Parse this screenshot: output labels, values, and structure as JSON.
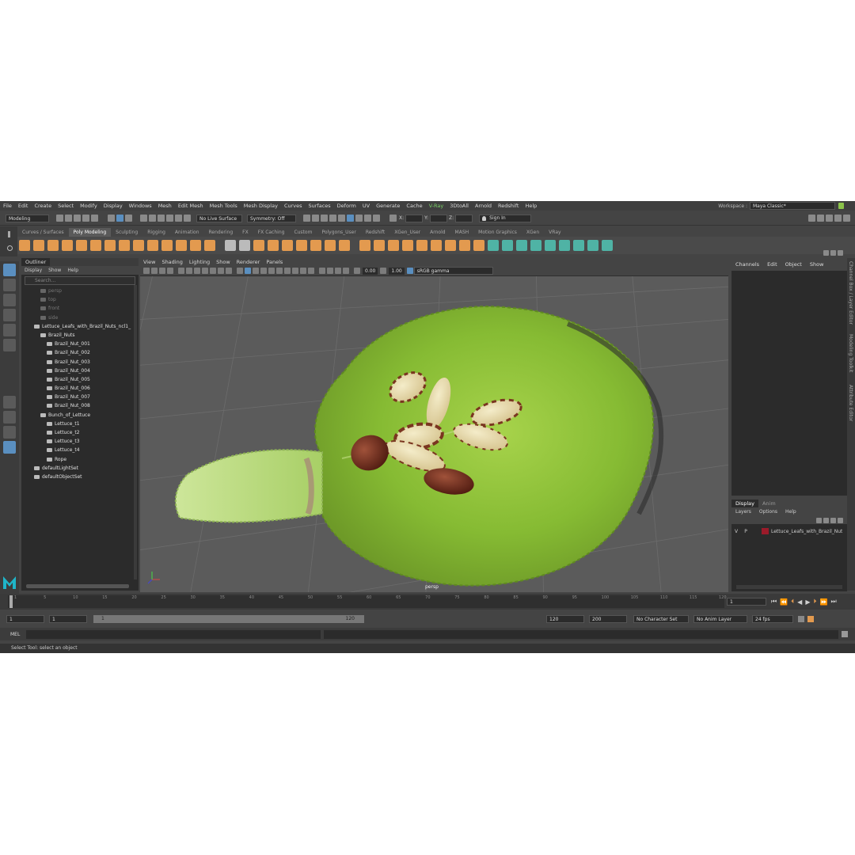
{
  "menu": [
    "File",
    "Edit",
    "Create",
    "Select",
    "Modify",
    "Display",
    "Windows",
    "Mesh",
    "Edit Mesh",
    "Mesh Tools",
    "Mesh Display",
    "Curves",
    "Surfaces",
    "Deform",
    "UV",
    "Generate",
    "Cache",
    "V-Ray",
    "3DtoAll",
    "Arnold",
    "Redshift",
    "Help"
  ],
  "workspace": {
    "label": "Workspace :",
    "value": "Maya Classic*"
  },
  "status": {
    "mode": "Modeling",
    "live": "No Live Surface",
    "symmetry": "Symmetry: Off",
    "x_label": "X:",
    "y_label": "Y:",
    "z_label": "Z:",
    "sign_in": "Sign In"
  },
  "shelf_tabs": [
    "Curves / Surfaces",
    "Poly Modeling",
    "Sculpting",
    "Rigging",
    "Animation",
    "Rendering",
    "FX",
    "FX Caching",
    "Custom",
    "Polygons_User",
    "Redshift",
    "XGen_User",
    "Arnold",
    "MASH",
    "Motion Graphics",
    "XGen",
    "VRay"
  ],
  "shelf_active": "Poly Modeling",
  "outliner": {
    "title": "Outliner",
    "menu": [
      "Display",
      "Show",
      "Help"
    ],
    "search": "Search...",
    "nodes": [
      {
        "label": "persp",
        "indent": 2,
        "dim": true
      },
      {
        "label": "top",
        "indent": 2,
        "dim": true
      },
      {
        "label": "front",
        "indent": 2,
        "dim": true
      },
      {
        "label": "side",
        "indent": 2,
        "dim": true
      },
      {
        "label": "Lettuce_Leafs_with_Brazil_Nuts_ncl1_",
        "indent": 1,
        "dim": false
      },
      {
        "label": "Brazil_Nuts",
        "indent": 2,
        "dim": false
      },
      {
        "label": "Brazil_Nut_001",
        "indent": 3,
        "dim": false
      },
      {
        "label": "Brazil_Nut_002",
        "indent": 3,
        "dim": false
      },
      {
        "label": "Brazil_Nut_003",
        "indent": 3,
        "dim": false
      },
      {
        "label": "Brazil_Nut_004",
        "indent": 3,
        "dim": false
      },
      {
        "label": "Brazil_Nut_005",
        "indent": 3,
        "dim": false
      },
      {
        "label": "Brazil_Nut_006",
        "indent": 3,
        "dim": false
      },
      {
        "label": "Brazil_Nut_007",
        "indent": 3,
        "dim": false
      },
      {
        "label": "Brazil_Nut_008",
        "indent": 3,
        "dim": false
      },
      {
        "label": "Bunch_of_Lettuce",
        "indent": 2,
        "dim": false
      },
      {
        "label": "Lettuce_t1",
        "indent": 3,
        "dim": false
      },
      {
        "label": "Lettuce_t2",
        "indent": 3,
        "dim": false
      },
      {
        "label": "Lettuce_t3",
        "indent": 3,
        "dim": false
      },
      {
        "label": "Lettuce_t4",
        "indent": 3,
        "dim": false
      },
      {
        "label": "Rope",
        "indent": 3,
        "dim": false
      },
      {
        "label": "defaultLightSet",
        "indent": 1,
        "dim": false
      },
      {
        "label": "defaultObjectSet",
        "indent": 1,
        "dim": false
      }
    ]
  },
  "viewport": {
    "menu": [
      "View",
      "Shading",
      "Lighting",
      "Show",
      "Renderer",
      "Panels"
    ],
    "exposure": "0.00",
    "gamma": "1.00",
    "colorspace": "sRGB gamma",
    "camera": "persp"
  },
  "channel_box": {
    "menu": [
      "Channels",
      "Edit",
      "Object",
      "Show"
    ]
  },
  "side_tabs": [
    "Channel Box / Layer Editor",
    "Modeling Toolkit",
    "Attribute Editor"
  ],
  "layer_editor": {
    "tabs": [
      "Display",
      "Anim"
    ],
    "menu": [
      "Layers",
      "Options",
      "Help"
    ],
    "layer_v": "V",
    "layer_p": "P",
    "layer_name": "Lettuce_Leafs_with_Brazil_Nuts",
    "layer_color": "#9b1b2a"
  },
  "timeline": {
    "ticks": [
      "1",
      "5",
      "10",
      "15",
      "20",
      "25",
      "30",
      "35",
      "40",
      "45",
      "50",
      "55",
      "60",
      "65",
      "70",
      "75",
      "80",
      "85",
      "90",
      "95",
      "100",
      "105",
      "110",
      "115",
      "120"
    ],
    "current": "1"
  },
  "range": {
    "start": "1",
    "start2": "1",
    "slider_start": "1",
    "slider_end": "120",
    "end": "120",
    "end2": "200",
    "character": "No Character Set",
    "anim_layer": "No Anim Layer",
    "fps": "24 fps"
  },
  "command": {
    "label": "MEL"
  },
  "help_line": "Select Tool: select an object",
  "colors": {
    "accent": "#5a8fc0",
    "shelf_orange": "#e39a4f",
    "shelf_teal": "#4fb3a5",
    "lettuce": "#8fc23a",
    "nut": "#6b2a1c"
  }
}
